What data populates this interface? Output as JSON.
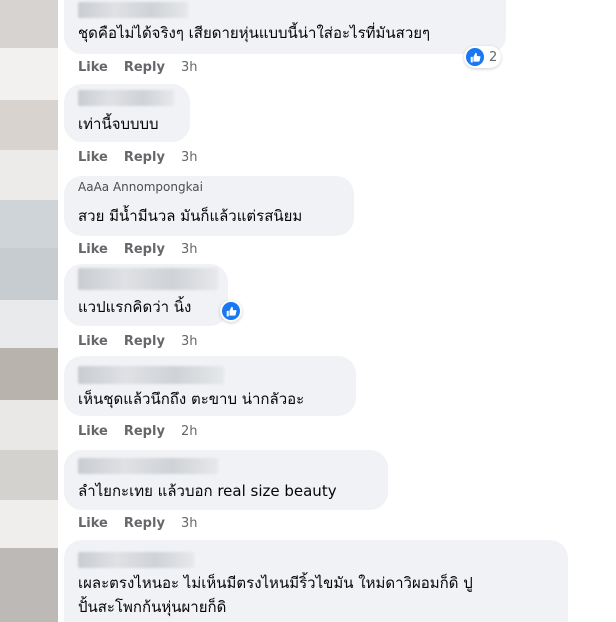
{
  "comments": [
    {
      "text": "ชุดคือไม่ได้จริงๆ เสียดายหุ่นแบบนี้น่าใส่อะไรที่มันสวยๆ",
      "like": "Like",
      "reply": "Reply",
      "time": "3h",
      "reaction_count": "2"
    },
    {
      "text": "เท่านี้จบบบบ",
      "like": "Like",
      "reply": "Reply",
      "time": "3h"
    },
    {
      "name_partial": "AaAa Annompongkai",
      "text": "สวย มีน้ำมีนวล มันก็แล้วแต่รสนิยม",
      "like": "Like",
      "reply": "Reply",
      "time": "3h"
    },
    {
      "text": "แวปแรกคิดว่า นิ้ง",
      "like": "Like",
      "reply": "Reply",
      "time": "3h"
    },
    {
      "text": "เห็นชุดแล้วนึกถึง ตะขาบ น่ากลัวอะ",
      "like": "Like",
      "reply": "Reply",
      "time": "2h"
    },
    {
      "text": "ลำไยกะเทย แล้วบอก real size beauty",
      "like": "Like",
      "reply": "Reply",
      "time": "3h"
    },
    {
      "text_line1": "เผละตรงไหนอะ ไม่เห็นมีตรงไหนมีริ้วไขมัน ใหม่ดาวิผอมก็ดิ ปู",
      "text_line2": "ปั้นสะโพกก้นหุ่นผายก็ดิ"
    }
  ],
  "colors": {
    "bubble": "#f0f2f5",
    "action": "#65676b",
    "accent": "#1877f2"
  }
}
